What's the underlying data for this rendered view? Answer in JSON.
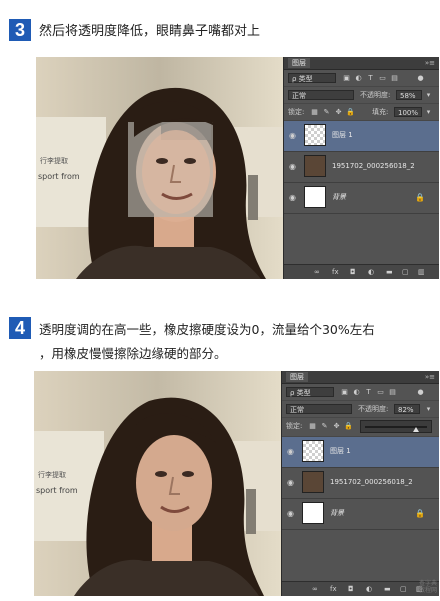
{
  "step3": {
    "number": "3",
    "text": "然后将透明度降低，眼睛鼻子嘴都对上"
  },
  "step4": {
    "number": "4",
    "line1": "透明度调的在高一些，橡皮擦硬度设为0，流量给个30%左右",
    "line2": "，用橡皮慢慢擦除边缘硬的部分。"
  },
  "photo_sign": {
    "line1": "行李提取",
    "line2": "sport from"
  },
  "panel1": {
    "tab": "图层",
    "filter_label": "ρ 类型",
    "blend_mode": "正常",
    "opacity_label": "不透明度:",
    "opacity_value": "58%",
    "lock_label": "锁定:",
    "fill_label": "填充:",
    "fill_value": "100%",
    "layers": [
      {
        "name": "图层 1",
        "selected": true
      },
      {
        "name": "1951702_000256018_2",
        "selected": false
      },
      {
        "name": "背景",
        "selected": false
      }
    ]
  },
  "panel2": {
    "tab": "图层",
    "filter_label": "ρ 类型",
    "blend_mode": "正常",
    "opacity_label": "不透明度:",
    "opacity_value": "82%",
    "lock_label": "锁定:",
    "slider_fraction": 0.82,
    "layers": [
      {
        "name": "图层 1",
        "selected": true
      },
      {
        "name": "1951702_000256018_2",
        "selected": false
      },
      {
        "name": "背景",
        "selected": false
      }
    ]
  },
  "watermark": {
    "line1": "查字典",
    "line2": "教程网"
  },
  "icons": {
    "eye": "eye-icon",
    "lock": "lock-icon",
    "layer_lock": "lock-icon",
    "link": "link-icon",
    "fx": "fx-icon",
    "mask": "mask-icon",
    "adjustment": "adjustment-icon",
    "folder": "folder-icon",
    "new_layer": "new-layer-icon",
    "trash": "trash-icon"
  },
  "colors": {
    "step_badge": "#1f5bb5",
    "ps_panel": "#535353",
    "selected_layer": "#5b6e8e"
  }
}
